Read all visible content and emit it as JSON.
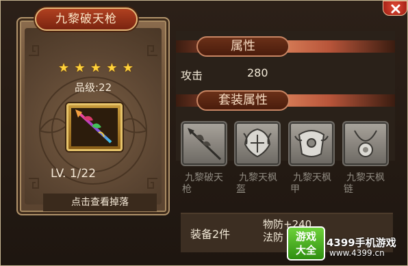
{
  "item": {
    "name": "九黎破天枪",
    "stars": [
      "★",
      "★",
      "★",
      "★",
      "★"
    ],
    "grade": "品级:22",
    "level": "LV. 1/22",
    "drop_button": "点击查看掉落"
  },
  "attributes": {
    "header": "属性",
    "attack_label": "攻击",
    "attack_value": "280"
  },
  "set": {
    "header": "套装属性",
    "pieces": [
      {
        "line1": "九黎破天",
        "line2": "枪",
        "icon": "spear-icon"
      },
      {
        "line1": "九黎天枫",
        "line2": "盔",
        "icon": "helmet-icon"
      },
      {
        "line1": "九黎天枫",
        "line2": "甲",
        "icon": "armor-icon"
      },
      {
        "line1": "九黎天枫",
        "line2": "链",
        "icon": "necklace-icon"
      }
    ],
    "bonus_label": "装备2件",
    "bonus_lines": [
      "物防+240",
      "法防"
    ]
  },
  "watermark": {
    "logo": [
      "游戏",
      "大全"
    ],
    "name": "4399手机游戏",
    "url": "www.4399.cn"
  },
  "colors": {
    "star": "#ffd23a",
    "title_plate": "#b04020",
    "header_pill": "#6a3018",
    "set_name_gray": "#8f8a80"
  }
}
